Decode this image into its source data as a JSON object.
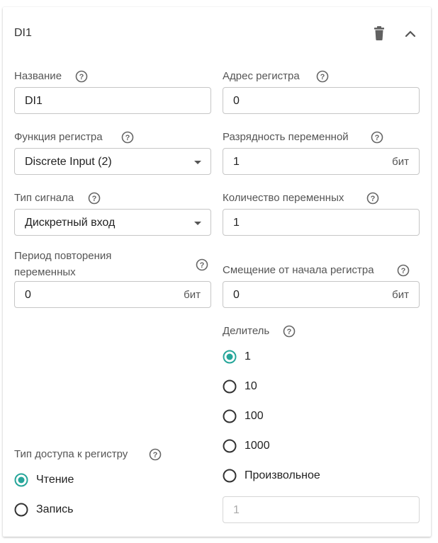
{
  "header": {
    "title": "DI1",
    "delete_icon": "trash-icon",
    "collapse_icon": "chevron-up-icon"
  },
  "colors": {
    "accent": "#26a69a",
    "border": "#c6c6c6",
    "label": "#555555"
  },
  "fields": {
    "name": {
      "label": "Название",
      "value": "DI1"
    },
    "register_address": {
      "label": "Адрес регистра",
      "value": "0"
    },
    "register_function": {
      "label": "Функция регистра",
      "value": "Discrete Input (2)"
    },
    "variable_bit_depth": {
      "label": "Разрядность переменной",
      "value": "1",
      "unit": "бит"
    },
    "signal_type": {
      "label": "Тип сигнала",
      "value": "Дискретный вход"
    },
    "variable_count": {
      "label": "Количество переменных",
      "value": "1"
    },
    "repeat_period": {
      "label_line1": "Период повторения",
      "label_line2": "переменных",
      "value": "0",
      "unit": "бит"
    },
    "register_offset": {
      "label": "Смещение от начала регистра",
      "value": "0",
      "unit": "бит"
    }
  },
  "divider": {
    "label": "Делитель",
    "options": [
      {
        "label": "1",
        "selected": true
      },
      {
        "label": "10",
        "selected": false
      },
      {
        "label": "100",
        "selected": false
      },
      {
        "label": "1000",
        "selected": false
      },
      {
        "label": "Произвольное",
        "selected": false
      }
    ],
    "custom_value": "1"
  },
  "access": {
    "label": "Тип доступа к регистру",
    "options": [
      {
        "label": "Чтение",
        "selected": true
      },
      {
        "label": "Запись",
        "selected": false
      }
    ]
  }
}
